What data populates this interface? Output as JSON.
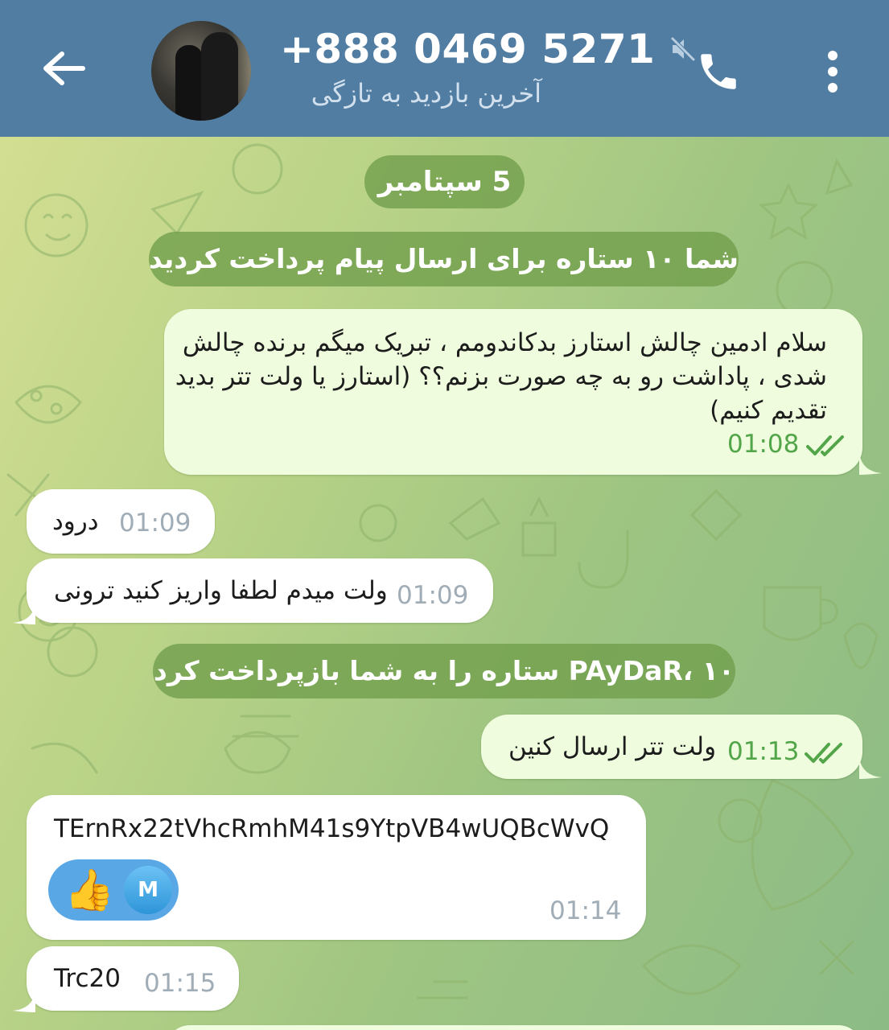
{
  "header": {
    "title": "+888 0469 5271",
    "status": "آخرین بازدید به تازگی",
    "background": "#517da2",
    "icons": {
      "back": "arrow-left-icon",
      "muted": "muted-speaker-icon",
      "call": "phone-icon",
      "more": "more-vertical-icon"
    }
  },
  "chat": {
    "date_label": "5 سپتامبر",
    "service_paid": "شما ۱۰ ستاره برای ارسال پیام پرداخت کردید",
    "service_refund": "PAyDaR، ۱۰ ستاره را به شما بازپرداخت کرد",
    "messages": [
      {
        "direction": "outgoing",
        "lines": [
          "سلام ادمین چالش استارز بدکاندومم ، تبریک میگم برنده چالش",
          "شدی ، پاداشت رو به چه صورت بزنم؟؟ (استارز یا ولت تتر بدید",
          "تقدیم کنیم)"
        ],
        "time": "01:08",
        "read": true
      },
      {
        "direction": "incoming",
        "text": "درود",
        "time": "01:09"
      },
      {
        "direction": "incoming",
        "text": "ولت میدم لطفا واریز کنید ترونی",
        "time": "01:09"
      },
      {
        "direction": "outgoing",
        "text": "ولت تتر ارسال کنین",
        "time": "01:13",
        "read": true
      },
      {
        "direction": "incoming",
        "text": "TErnRx22tVhcRmhM41s9YtpVB4wUQBcWvQ",
        "time": "01:14",
        "reaction": {
          "emoji": "👍",
          "avatar_letter": "M"
        }
      },
      {
        "direction": "incoming",
        "text": "Trc20",
        "time": "01:15"
      }
    ]
  },
  "colors": {
    "outgoing_bubble": "#effdde",
    "incoming_bubble": "#ffffff",
    "outgoing_time": "#53a549",
    "incoming_time": "#a0acb6",
    "service_pill": "#709e4a",
    "reaction_bg": "#5aa7e6"
  }
}
